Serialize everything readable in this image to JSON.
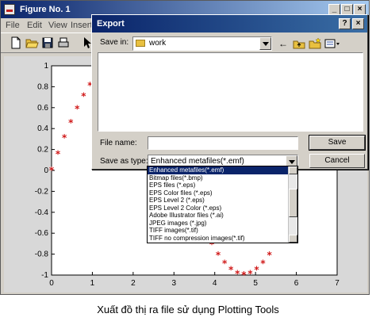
{
  "figure": {
    "title": "Figure No. 1",
    "menu": [
      "File",
      "Edit",
      "View",
      "Insert"
    ],
    "window_buttons": [
      "_",
      "□",
      "×"
    ]
  },
  "chart_data": {
    "type": "scatter",
    "x": [
      0,
      0.157,
      0.314,
      0.471,
      0.628,
      0.785,
      0.942,
      3.927,
      4.084,
      4.241,
      4.398,
      4.555,
      4.712,
      4.869,
      5.026,
      5.183,
      5.34
    ],
    "y": [
      0,
      0.156,
      0.309,
      0.454,
      0.588,
      0.707,
      0.809,
      -0.707,
      -0.809,
      -0.891,
      -0.951,
      -0.988,
      -1.0,
      -0.988,
      -0.951,
      -0.891,
      -0.809
    ],
    "xlim": [
      0,
      7
    ],
    "ylim": [
      -1,
      1
    ],
    "xticks": [
      "0",
      "1",
      "2",
      "3",
      "4",
      "5",
      "6",
      "7"
    ],
    "yticks": [
      "1",
      "0.8",
      "0.6",
      "0.4",
      "0.2",
      "0",
      "-0.2",
      "-0.4",
      "-0.6",
      "-0.8",
      "-1"
    ],
    "marker_color": "#d01818"
  },
  "dialog": {
    "title": "Export",
    "title_buttons": [
      "?",
      "×"
    ],
    "save_in_label": "Save in:",
    "save_in_value": "work",
    "file_name_label": "File name:",
    "file_name_value": "",
    "save_as_type_label": "Save as type:",
    "save_as_type_value": "Enhanced metafiles(*.emf)",
    "save_button": "Save",
    "cancel_button": "Cancel"
  },
  "dropdown": {
    "items": [
      "Enhanced metafiles(*.emf)",
      "Bitmap files(*.bmp)",
      "EPS files (*.eps)",
      "EPS Color files (*.eps)",
      "EPS Level 2 (*.eps)",
      "EPS Level 2 Color (*.eps)",
      "Adobe Illustrator files (*.ai)",
      "JPEG images (*.jpg)",
      "TIFF images(*.tif)",
      "TIFF no compression images(*.tif)"
    ],
    "selected_index": 0
  },
  "caption": "Xuất đồ thị ra file sử dụng Plotting Tools"
}
